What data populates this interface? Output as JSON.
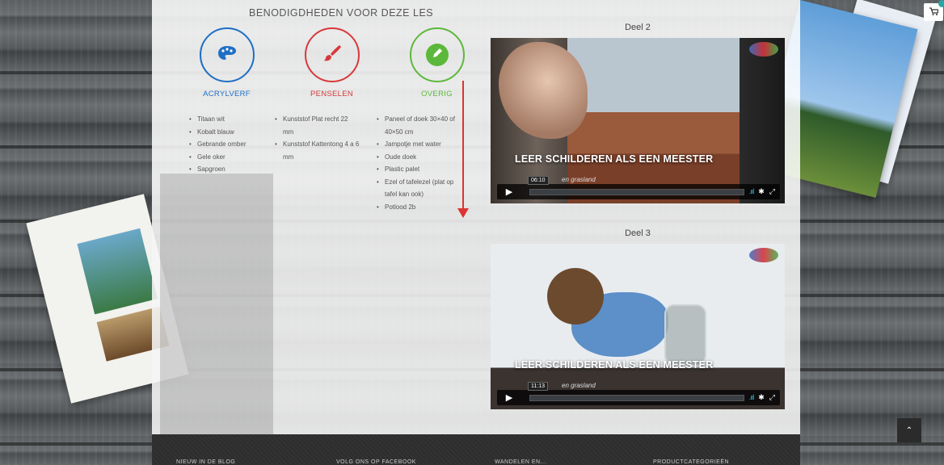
{
  "supplies": {
    "title": "BENODIGDHEDEN VOOR DEZE LES",
    "columns": [
      {
        "label": "ACRYLVERF",
        "color": "#1f6fc5",
        "icon": "palette-icon",
        "items": [
          "Titaan wit",
          "Kobalt blauw",
          "Gebrande omber",
          "Gele oker",
          "Sapgroen"
        ]
      },
      {
        "label": "PENSELEN",
        "color": "#d9383a",
        "icon": "brush-icon",
        "items": [
          "Kunststof Plat recht 22 mm",
          "Kunststof Kattentong 4 a 6 mm"
        ]
      },
      {
        "label": "OVERIG",
        "color": "#5cb83a",
        "icon": "pencil-icon",
        "items": [
          "Paneel of doek 30×40 of 40×50 cm",
          "Jampotje met water",
          "Oude doek",
          "Plastic palet",
          "Ezel of tafelezel (plat op tafel kan ook)",
          "Potlood 2b"
        ]
      }
    ]
  },
  "videos": [
    {
      "label": "Deel 2",
      "title": "LEER SCHILDEREN ALS EEN MEESTER",
      "subtitle": "en grasland",
      "time": "06:10"
    },
    {
      "label": "Deel 3",
      "title": "LEER SCHILDEREN ALS EEN MEESTER",
      "subtitle": "en grasland",
      "time": "11:13"
    }
  ],
  "footer": {
    "columns": [
      "NIEUW IN DE BLOG",
      "VOLG ONS OP FACEBOOK",
      "WANDELEN EN...",
      "PRODUCTCATEGORIEËN"
    ]
  },
  "cart": {
    "icon": "cart-icon"
  },
  "scroll_top": {
    "icon": "chevron-up-icon",
    "symbol": "⌃"
  }
}
